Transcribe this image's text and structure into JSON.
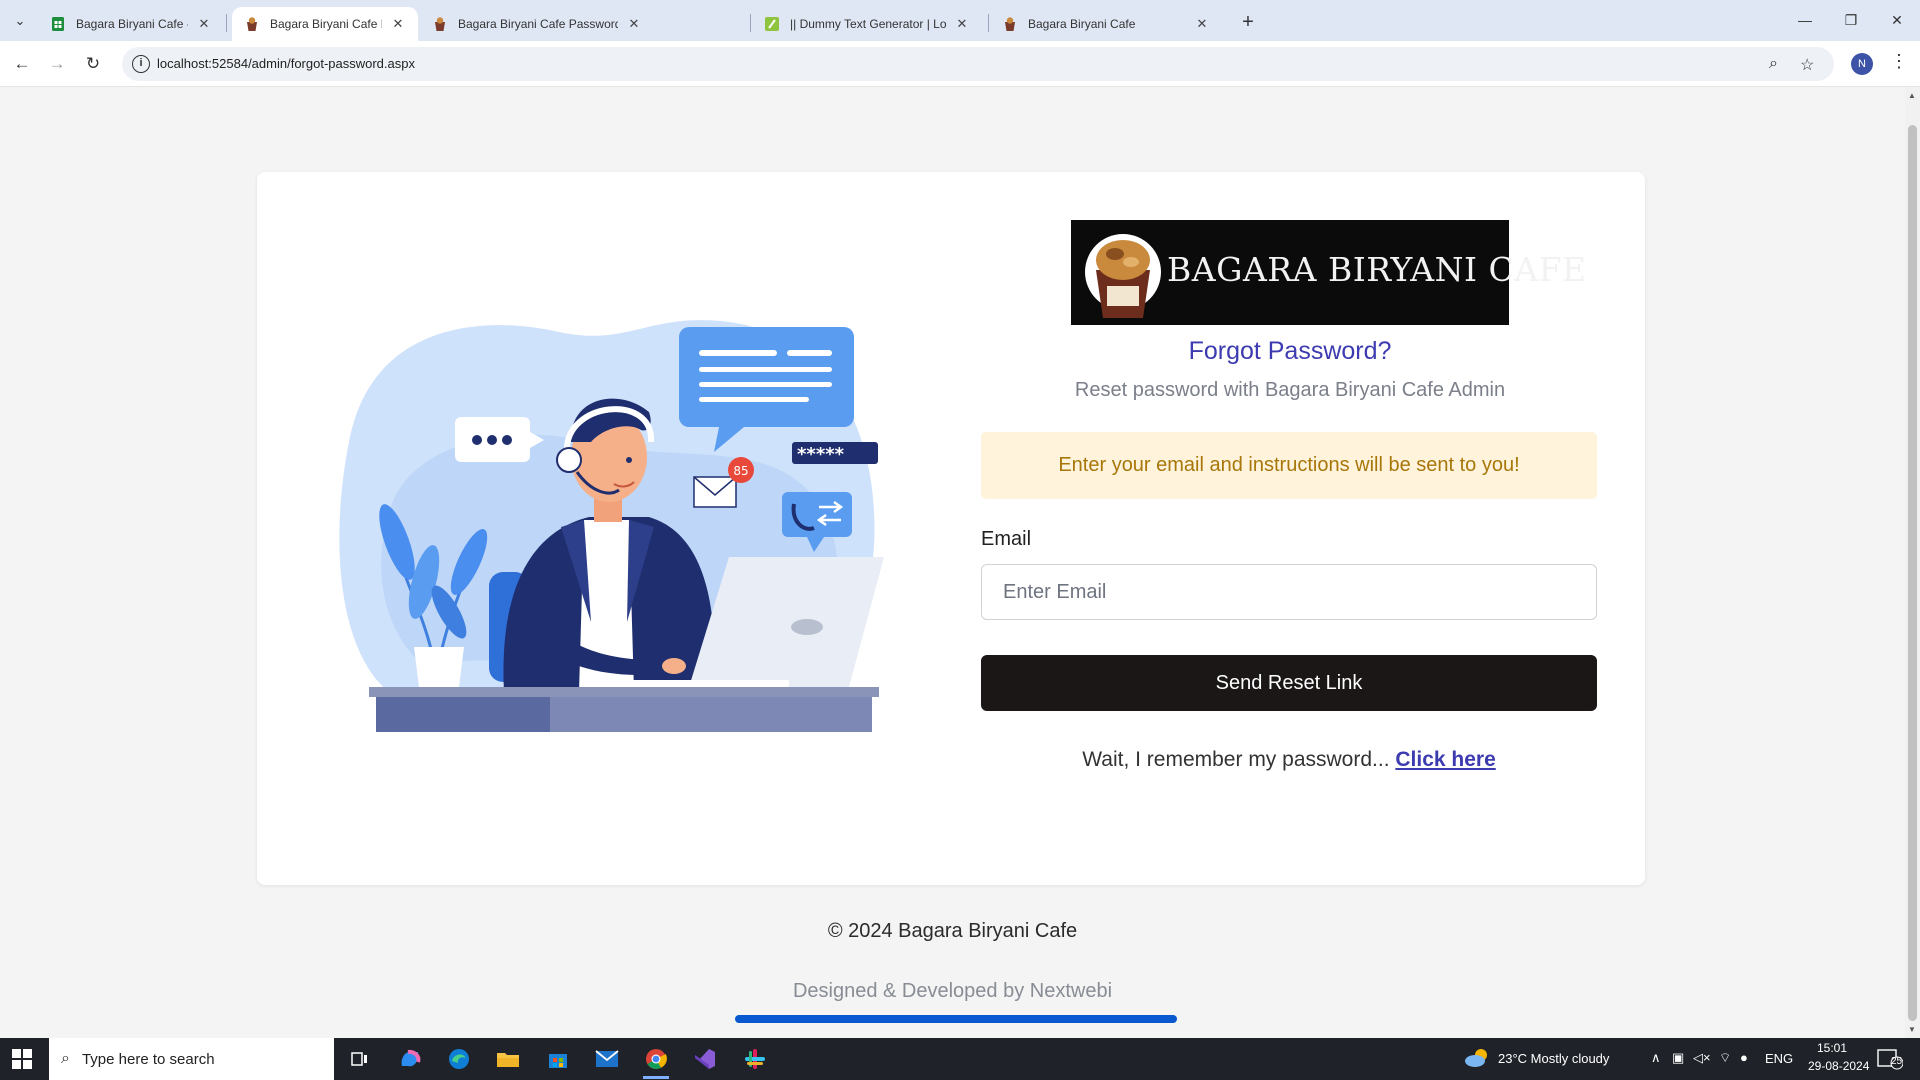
{
  "browser": {
    "tabs": [
      {
        "label": "Bagara Biryani Cafe - Google Sheets",
        "favicon": "sheets-icon",
        "active": false
      },
      {
        "label": "Bagara Biryani Cafe Password Reset",
        "favicon": "cafe-favicon",
        "active": true
      },
      {
        "label": "Bagara Biryani Cafe Password Reset",
        "favicon": "cafe-favicon",
        "active": false
      },
      {
        "label": "|| Dummy Text Generator | Lorem Ipsum",
        "favicon": "dummy-text-icon",
        "active": false
      },
      {
        "label": "Bagara Biryani Cafe",
        "favicon": "cafe-favicon",
        "active": false
      }
    ],
    "url": "localhost:52584/admin/forgot-password.aspx",
    "profile_initial": "N"
  },
  "page": {
    "logo_text": "BAGARA BIRYANI CAFE",
    "logo_badge": "BBC BUCKET",
    "illustration_badge_count": "85",
    "illustration_password_mask": "*****",
    "heading": "Forgot Password?",
    "subheading": "Reset password with Bagara Biryani Cafe Admin",
    "alert": "Enter your email and instructions will be sent to you!",
    "email_label": "Email",
    "email_placeholder": "Enter Email",
    "email_value": "",
    "send_button": "Send Reset Link",
    "remember_text": "Wait, I remember my password...",
    "remember_link": "Click here",
    "copyright": "© 2024 Bagara Biryani Cafe",
    "credit": "Designed & Developed by Nextwebi"
  },
  "taskbar": {
    "search_placeholder": "Type here to search",
    "weather": "23°C  Mostly cloudy",
    "language": "ENG",
    "time": "15:01",
    "date": "29-08-2024",
    "notifications": "25"
  },
  "colors": {
    "accent": "#3d3bb0",
    "alert_bg": "#fff3dc",
    "alert_text": "#a8770a",
    "button_bg": "#1b1717",
    "credit_bar": "#0a58d0"
  }
}
